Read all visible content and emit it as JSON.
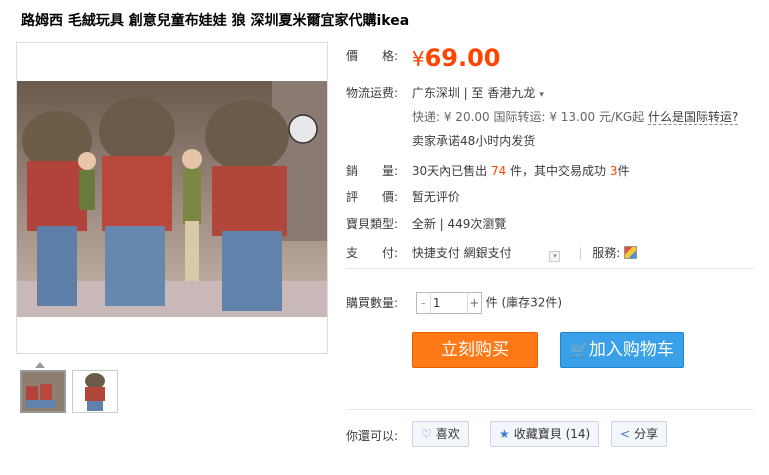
{
  "title": "路姆西 毛絨玩具 創意兒童布娃娃 狼 深圳夏米爾宜家代購ikea",
  "price": {
    "label": "價　　格:",
    "currency": "¥",
    "value": "69.00"
  },
  "shipping": {
    "label": "物流运费:",
    "route": "广东深圳 | 至  香港九龙",
    "fee_text": "快递: ¥ 20.00 国际转运: ¥ 13.00 元/KG起",
    "intl_link": "什么是国际转运?",
    "ship_time": "卖家承诺48小时内发货"
  },
  "sales": {
    "label": "銷　　量:",
    "prefix": "30天內已售出",
    "sold": "74",
    "mid": "件，其中交易成功",
    "success": "3",
    "suffix": "件"
  },
  "review": {
    "label": "評　　價:",
    "value": "暂无评价"
  },
  "item_type": {
    "label": "寶貝類型:",
    "value": "全新  |  449次瀏覽"
  },
  "payment": {
    "label": "支　　付:",
    "methods": "快捷支付  網銀支付",
    "service_label": "服務:"
  },
  "quantity": {
    "label": "購買數量:",
    "minus": "-",
    "value": "1",
    "plus": "+",
    "stock": "件 (庫存32件)"
  },
  "buttons": {
    "buy": "立刻购买",
    "cart": "加入购物车"
  },
  "actions": {
    "label": "你還可以:",
    "like": "喜欢",
    "favorite": "收藏寶貝 (14)",
    "share": "分享"
  },
  "colors": {
    "accent": "#ff4400",
    "buy": "#ff7a16",
    "cart": "#3aa0e8"
  }
}
